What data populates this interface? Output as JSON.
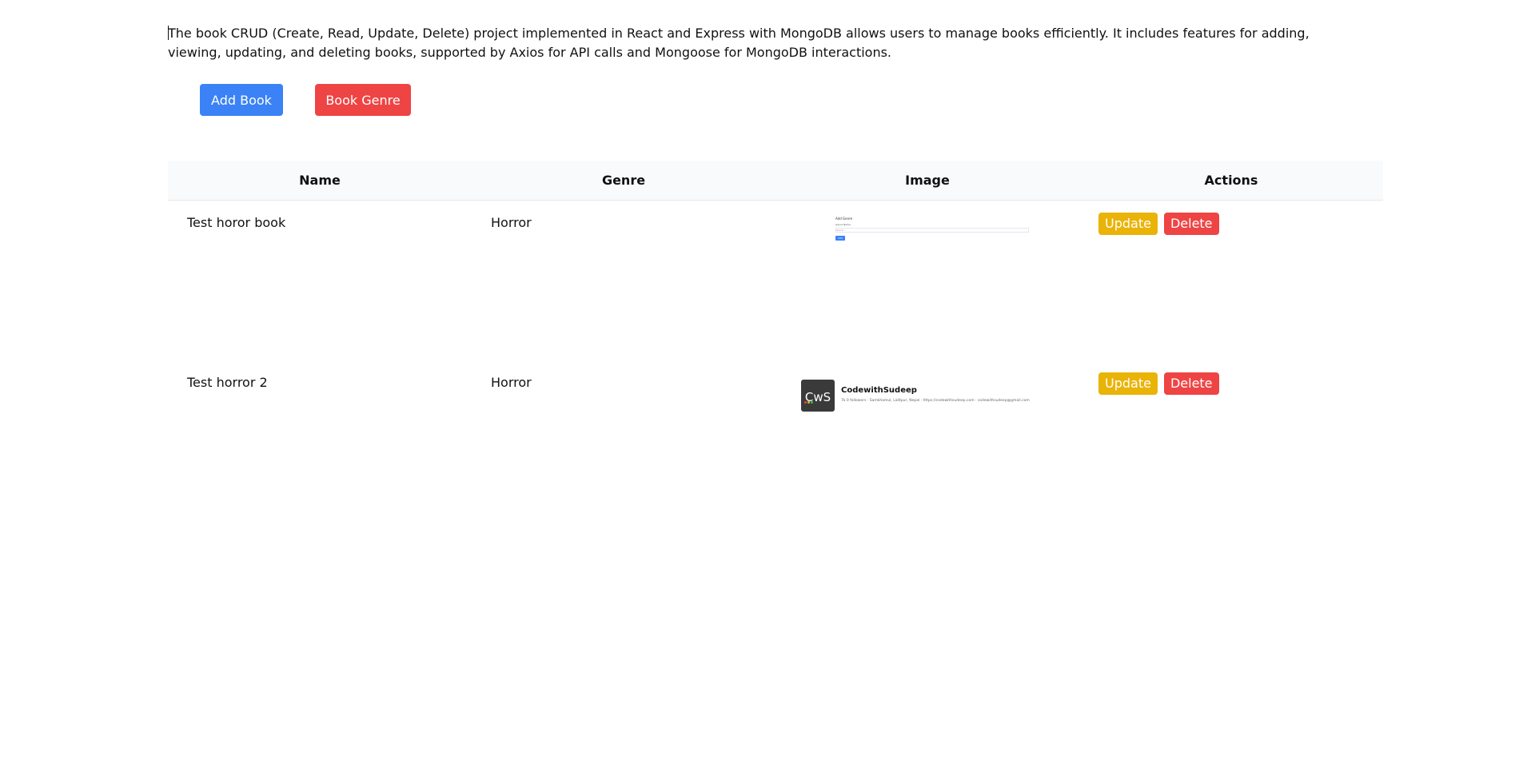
{
  "description": "The book CRUD (Create, Read, Update, Delete) project implemented in React and Express with MongoDB allows users to manage books efficiently. It includes features for adding, viewing, updating, and deleting books, supported by Axios for API calls and Mongoose for MongoDB interactions.",
  "toolbar": {
    "add_book_label": "Add Book",
    "book_genre_label": "Book Genre"
  },
  "table": {
    "headers": [
      "Name",
      "Genre",
      "Image",
      "Actions"
    ],
    "rows": [
      {
        "name": "Test horor book",
        "genre": "Horror",
        "update_label": "Update",
        "delete_label": "Delete",
        "thumbnail": {
          "title": "Add Genre",
          "label": "Genre Name",
          "input": "Genre",
          "button": "Add"
        }
      },
      {
        "name": "Test horror 2",
        "genre": "Horror",
        "update_label": "Update",
        "delete_label": "Delete",
        "thumbnail": {
          "logo": "CwS",
          "name": "CodewithSudeep",
          "meta": "7k 0 followers · Samkhamul, Lalitpur, Nepal · https://codewithsudeep.com · codewithsudeep@gmail.com"
        }
      }
    ]
  },
  "colors": {
    "primary": "#3b82f6",
    "danger": "#ef4444",
    "warning": "#eab308",
    "header_bg": "#f9fafb"
  }
}
